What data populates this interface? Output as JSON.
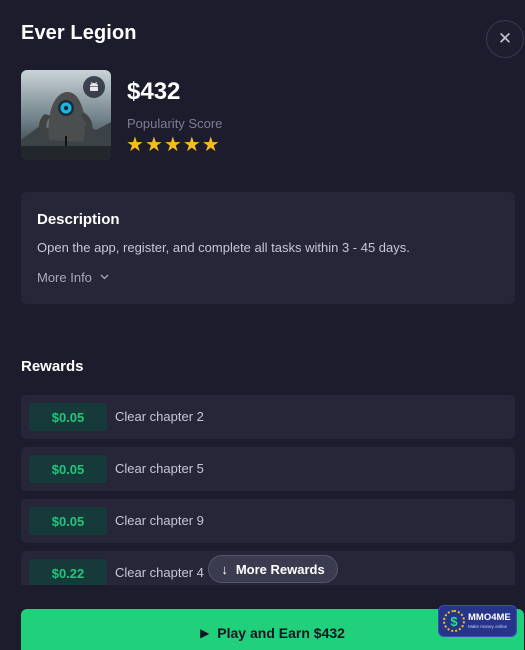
{
  "header": {
    "title": "Ever Legion",
    "close_icon": "close-icon"
  },
  "offer": {
    "price": "$432",
    "popularity_label": "Popularity Score",
    "rating": 5,
    "rating_max": 5,
    "platform_icon": "android-icon"
  },
  "description": {
    "title": "Description",
    "text": "Open the app, register, and complete all tasks within 3 - 45 days.",
    "more_info_label": "More Info"
  },
  "rewards": {
    "title": "Rewards",
    "items": [
      {
        "amount": "$0.05",
        "label": "Clear chapter 2"
      },
      {
        "amount": "$0.05",
        "label": "Clear chapter 5"
      },
      {
        "amount": "$0.05",
        "label": "Clear chapter 9"
      },
      {
        "amount": "$0.22",
        "label": "Clear chapter 4"
      }
    ],
    "more_label": "More Rewards"
  },
  "cta": {
    "label": "Play and Earn $432"
  },
  "watermark": {
    "main": "MMO4ME",
    "sub": "Make money online"
  },
  "colors": {
    "background": "#1d1c2c",
    "card": "#262638",
    "accent_green": "#20d07a",
    "reward_green": "#22c57b",
    "star": "#f7bd1c"
  }
}
